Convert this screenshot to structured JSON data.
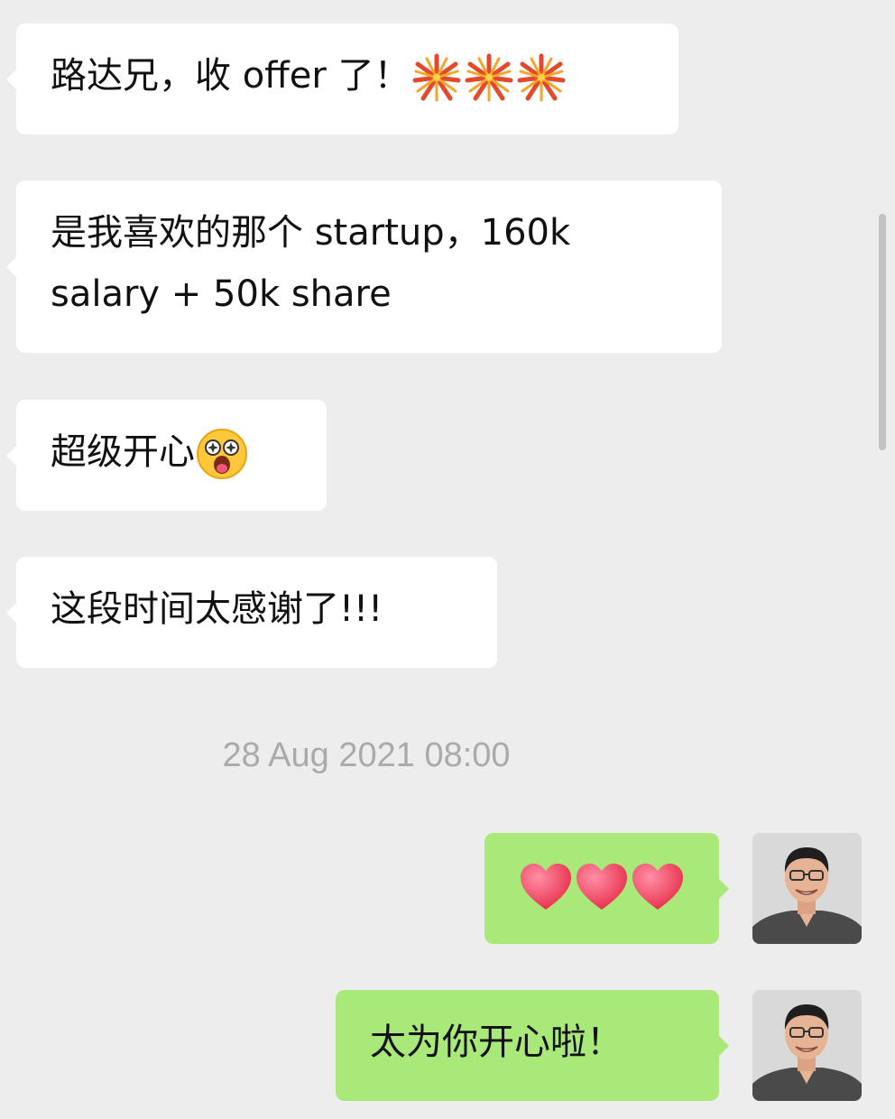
{
  "messages": [
    {
      "id": "m1",
      "side": "incoming",
      "text": "路达兄，收 offer 了！",
      "emoji": [
        "fireworks",
        "fireworks",
        "fireworks"
      ]
    },
    {
      "id": "m2",
      "side": "incoming",
      "text_line1": "是我喜欢的那个 startup，160k",
      "text_line2": "salary + 50k share"
    },
    {
      "id": "m3",
      "side": "incoming",
      "text": "超级开心",
      "emoji": [
        "star-struck-face"
      ]
    },
    {
      "id": "m4",
      "side": "incoming",
      "text": "这段时间太感谢了!!!"
    },
    {
      "id": "m5",
      "side": "outgoing",
      "emoji": [
        "red-heart",
        "red-heart",
        "red-heart"
      ]
    },
    {
      "id": "m6",
      "side": "outgoing",
      "text": "太为你开心啦！"
    }
  ],
  "timestamp": "28 Aug 2021 08:00",
  "colors": {
    "background": "#ededed",
    "incoming_bubble": "#ffffff",
    "outgoing_bubble": "#a9e97a",
    "timestamp_text": "#aaaaaa",
    "scrollbar": "#c2c2c2"
  },
  "icons": {
    "fireworks": "fireworks-emoji",
    "star_struck": "star-struck-emoji",
    "heart": "red-heart-emoji",
    "avatar": "user-avatar-photo"
  }
}
